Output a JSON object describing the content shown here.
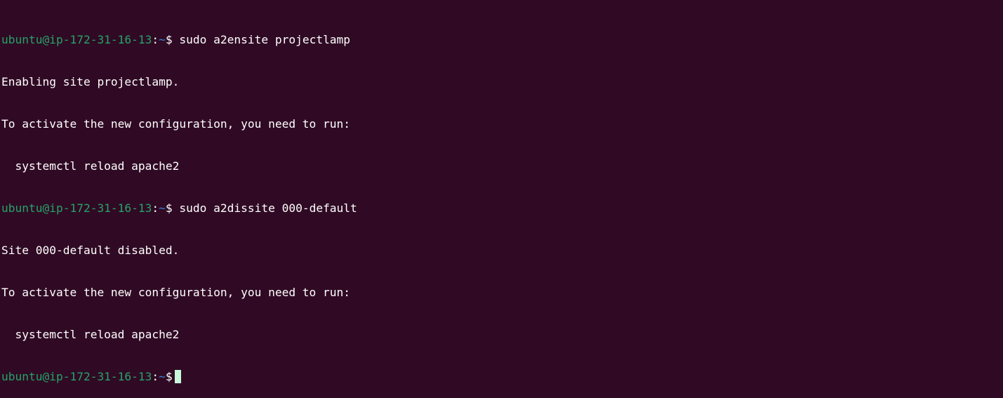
{
  "terminal": {
    "colors": {
      "background": "#300a24",
      "text": "#ffffff",
      "user_host": "#26a269",
      "path": "#3a82d4",
      "cursor": "#c8f7dc"
    },
    "lines": [
      {
        "type": "prompt",
        "user_host": "ubuntu@ip-172-31-16-13",
        "colon": ":",
        "path": "~",
        "symbol": "$ ",
        "command": "sudo a2ensite projectlamp"
      },
      {
        "type": "output",
        "text": "Enabling site projectlamp."
      },
      {
        "type": "output",
        "text": "To activate the new configuration, you need to run:"
      },
      {
        "type": "output",
        "text": "  systemctl reload apache2"
      },
      {
        "type": "prompt",
        "user_host": "ubuntu@ip-172-31-16-13",
        "colon": ":",
        "path": "~",
        "symbol": "$ ",
        "command": "sudo a2dissite 000-default"
      },
      {
        "type": "output",
        "text": "Site 000-default disabled."
      },
      {
        "type": "output",
        "text": "To activate the new configuration, you need to run:"
      },
      {
        "type": "output",
        "text": "  systemctl reload apache2"
      },
      {
        "type": "prompt",
        "user_host": "ubuntu@ip-172-31-16-13",
        "colon": ":",
        "path": "~",
        "symbol": "$",
        "command": "",
        "cursor": true
      }
    ]
  }
}
